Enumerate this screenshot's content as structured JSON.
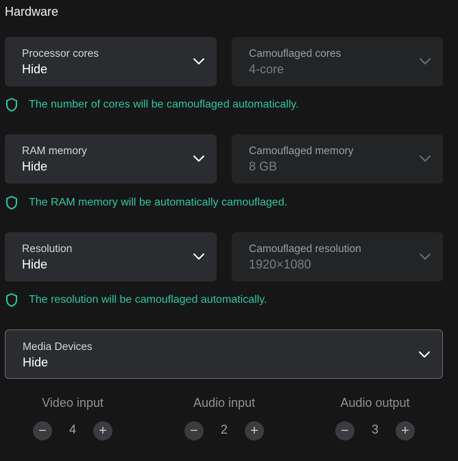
{
  "section": {
    "title": "Hardware"
  },
  "cores": {
    "label": "Processor cores",
    "value": "Hide",
    "camo_label": "Camouflaged cores",
    "camo_value": "4-core",
    "info": "The number of cores will be camouflaged automatically."
  },
  "ram": {
    "label": "RAM memory",
    "value": "Hide",
    "camo_label": "Camouflaged memory",
    "camo_value": "8 GB",
    "info": "The RAM memory will be automatically camouflaged."
  },
  "resolution": {
    "label": "Resolution",
    "value": "Hide",
    "camo_label": "Camouflaged resolution",
    "camo_value": "1920×1080",
    "info": "The resolution will be camouflaged automatically."
  },
  "media": {
    "label": "Media Devices",
    "value": "Hide",
    "video_input": {
      "label": "Video input",
      "count": "4"
    },
    "audio_input": {
      "label": "Audio input",
      "count": "2"
    },
    "audio_output": {
      "label": "Audio output",
      "count": "3"
    }
  },
  "colors": {
    "accent": "#2bc9a0",
    "background": "#161616",
    "field": "#2a2c2f"
  },
  "icons": {
    "chevron": "chevron-down-icon",
    "shield": "shield-icon",
    "minus": "minus-icon",
    "plus": "plus-icon"
  }
}
